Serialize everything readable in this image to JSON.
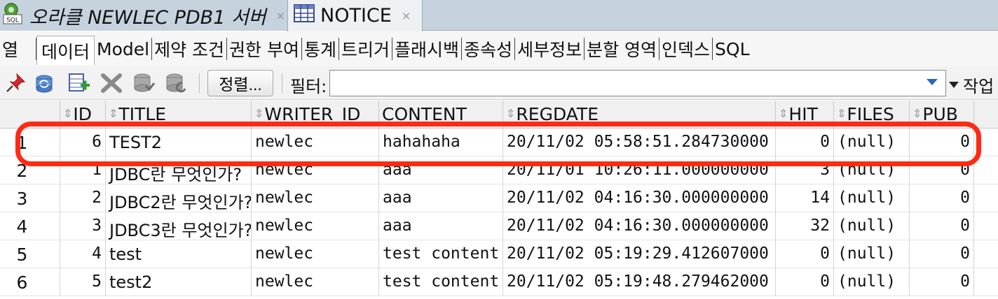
{
  "editor_tabs": [
    {
      "label": "오라클 NEWLEC PDB1 서버",
      "icon": "sql-worksheet-icon",
      "active": false
    },
    {
      "label": "NOTICE",
      "icon": "table-icon",
      "active": true
    }
  ],
  "close_glyph": "×",
  "sub_tabs": [
    "열",
    "데이터",
    "Model",
    "제약 조건",
    "권한 부여",
    "통계",
    "트리거",
    "플래시백",
    "종속성",
    "세부정보",
    "분할 영역",
    "인덱스",
    "SQL"
  ],
  "active_sub_tab": "데이터",
  "toolbar": {
    "icons": [
      "pin-icon",
      "refresh-icon",
      "insert-row-icon",
      "delete-row-icon",
      "commit-icon",
      "rollback-icon"
    ],
    "sort_label": "정렬...",
    "filter_label": "필터:",
    "filter_value": "",
    "actions_label": "작업"
  },
  "grid": {
    "columns": [
      "ID",
      "TITLE",
      "WRITER_ID",
      "CONTENT",
      "REGDATE",
      "HIT",
      "FILES",
      "PUB"
    ],
    "rows": [
      {
        "rownum": "1",
        "cells": [
          "6",
          "TEST2",
          "newlec",
          "hahahaha",
          "20/11/02 05:58:51.284730000",
          "0",
          "(null)",
          "0"
        ]
      },
      {
        "rownum": "2",
        "cells": [
          "1",
          "JDBC란 무엇인가?",
          "newlec",
          "aaa",
          "20/11/01 10:26:11.000000000",
          "3",
          "(null)",
          "0"
        ]
      },
      {
        "rownum": "3",
        "cells": [
          "2",
          "JDBC2란 무엇인가?",
          "newlec",
          "aaa",
          "20/11/02 04:16:30.000000000",
          "14",
          "(null)",
          "0"
        ]
      },
      {
        "rownum": "4",
        "cells": [
          "3",
          "JDBC3란 무엇인가?",
          "newlec",
          "aaa",
          "20/11/02 04:16:30.000000000",
          "32",
          "(null)",
          "0"
        ]
      },
      {
        "rownum": "5",
        "cells": [
          "4",
          "test",
          "newlec",
          "test content",
          "20/11/02 05:19:29.412607000",
          "0",
          "(null)",
          "0"
        ]
      },
      {
        "rownum": "6",
        "cells": [
          "5",
          "test2",
          "newlec",
          "test content",
          "20/11/02 05:19:48.279462000",
          "0",
          "(null)",
          "0"
        ]
      }
    ]
  },
  "colors": {
    "highlight": "#ff2a14",
    "tab_strip": "#c6d2de",
    "accent": "#2a62c9"
  }
}
